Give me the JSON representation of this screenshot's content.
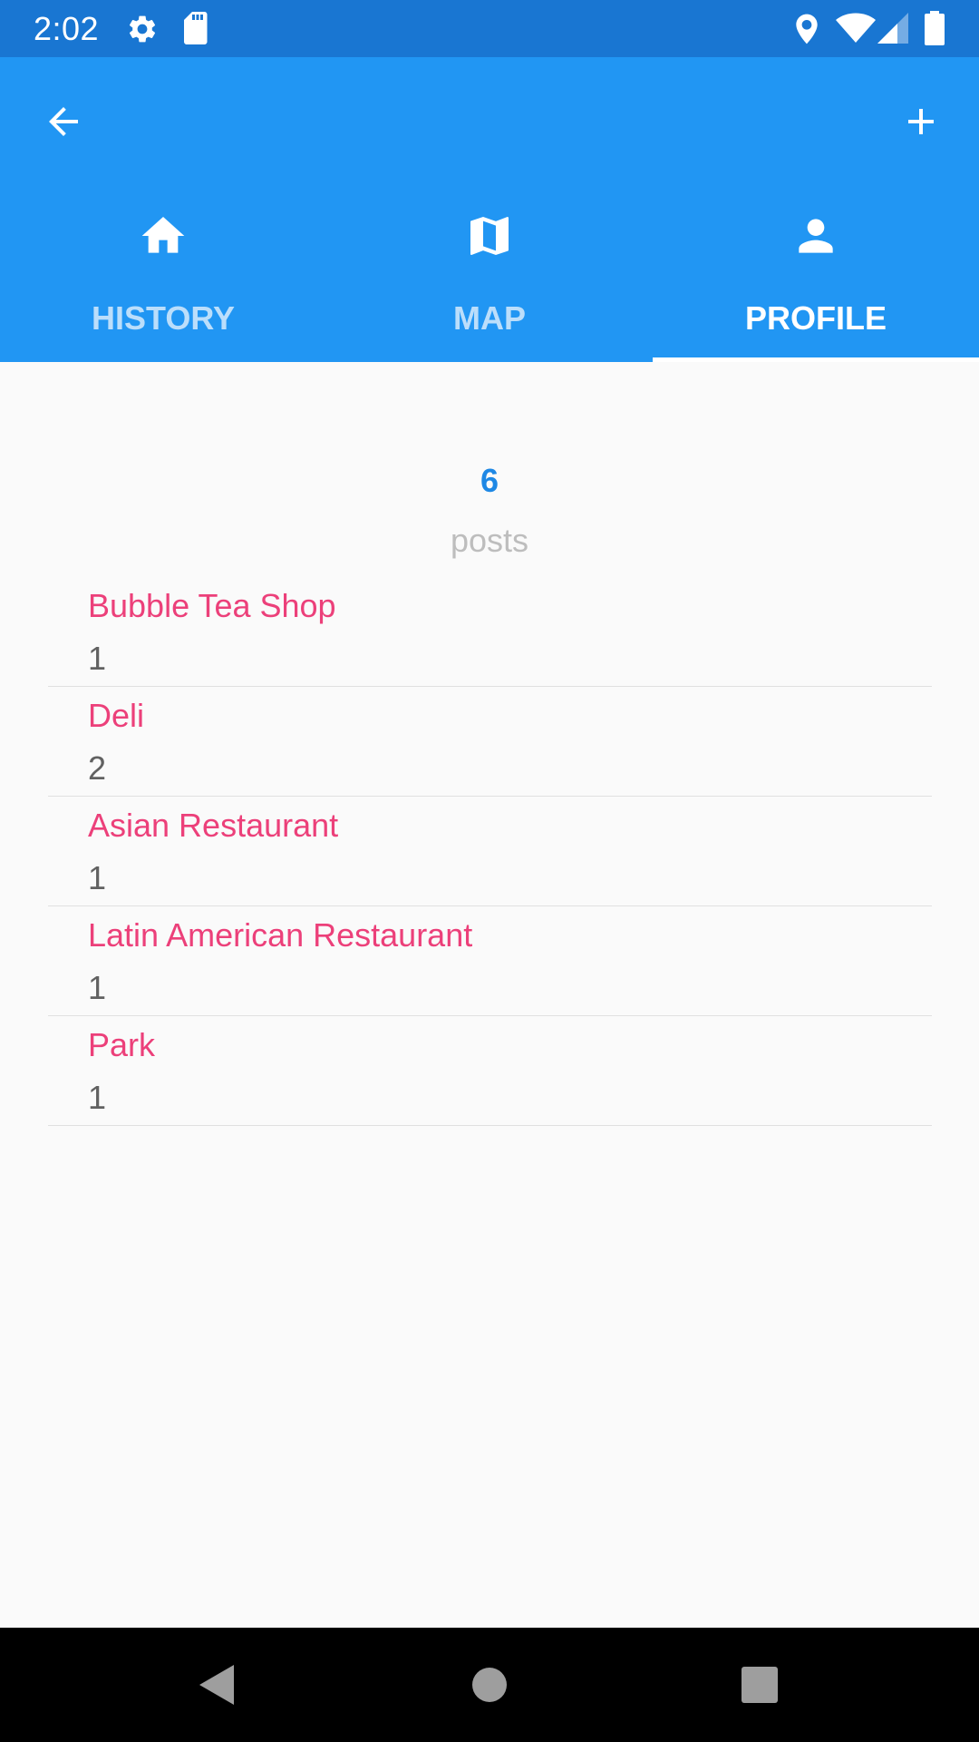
{
  "status_bar": {
    "time": "2:02",
    "icons": [
      "gear-icon",
      "sd-card-icon",
      "location-icon",
      "wifi-icon",
      "cell-signal-icon",
      "battery-icon"
    ]
  },
  "toolbar": {
    "back_icon": "arrow-left-icon",
    "add_icon": "plus-icon"
  },
  "tabs": [
    {
      "label": "HISTORY",
      "icon": "home-icon",
      "selected": false
    },
    {
      "label": "MAP",
      "icon": "map-icon",
      "selected": false
    },
    {
      "label": "PROFILE",
      "icon": "person-icon",
      "selected": true
    }
  ],
  "profile": {
    "post_count": "6",
    "post_label": "posts",
    "categories": [
      {
        "name": "Bubble Tea Shop",
        "count": "1"
      },
      {
        "name": "Deli",
        "count": "2"
      },
      {
        "name": "Asian Restaurant",
        "count": "1"
      },
      {
        "name": "Latin American Restaurant",
        "count": "1"
      },
      {
        "name": "Park",
        "count": "1"
      }
    ]
  },
  "nav_bar": {
    "icons": [
      "back-triangle-icon",
      "home-circle-icon",
      "recents-square-icon"
    ]
  },
  "colors": {
    "status_bar": "#1976D2",
    "app_bar": "#2196F3",
    "accent_blue": "#1E88E5",
    "category_pink": "#EC407A",
    "tab_inactive": "#BBDEFB",
    "tab_active": "#FFFFFF"
  }
}
